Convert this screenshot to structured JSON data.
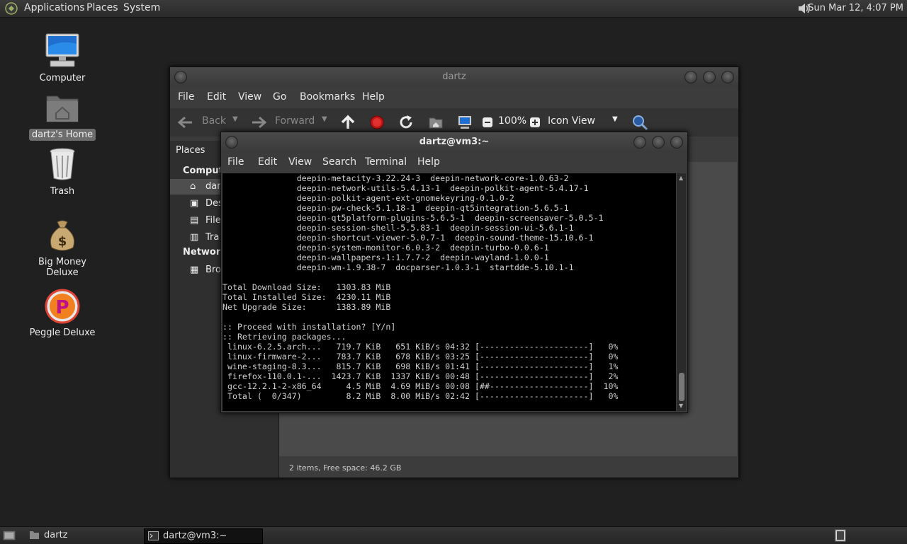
{
  "top_panel": {
    "menus": [
      "Applications",
      "Places",
      "System"
    ],
    "clock": "Sun Mar 12,  4:07 PM"
  },
  "desktop": {
    "icons": [
      {
        "label": "Computer"
      },
      {
        "label": "dartz's Home"
      },
      {
        "label": "Trash"
      },
      {
        "label": "Big Money Deluxe"
      },
      {
        "label": "Peggle Deluxe"
      }
    ]
  },
  "file_manager": {
    "title": "dartz",
    "menu": [
      "File",
      "Edit",
      "View",
      "Go",
      "Bookmarks",
      "Help"
    ],
    "toolbar": {
      "back": "Back",
      "forward": "Forward",
      "zoom": "100%",
      "view_mode": "Icon View"
    },
    "sidebar": {
      "header": "Places",
      "section_computer": "Compute",
      "items": [
        "dar",
        "Des",
        "File",
        "Tra"
      ],
      "section_network": "Network",
      "network_items": [
        "Bro"
      ]
    },
    "status": "2 items, Free space: 46.2 GB"
  },
  "terminal": {
    "title": "dartz@vm3:~",
    "menu": [
      "File",
      "Edit",
      "View",
      "Search",
      "Terminal",
      "Help"
    ],
    "lines": [
      "               deepin-metacity-3.22.24-3  deepin-network-core-1.0.63-2",
      "               deepin-network-utils-5.4.13-1  deepin-polkit-agent-5.4.17-1",
      "               deepin-polkit-agent-ext-gnomekeyring-0.1.0-2",
      "               deepin-pw-check-5.1.18-1  deepin-qt5integration-5.6.5-1",
      "               deepin-qt5platform-plugins-5.6.5-1  deepin-screensaver-5.0.5-1",
      "               deepin-session-shell-5.5.83-1  deepin-session-ui-5.6.1-1",
      "               deepin-shortcut-viewer-5.0.7-1  deepin-sound-theme-15.10.6-1",
      "               deepin-system-monitor-6.0.3-2  deepin-turbo-0.0.6-1",
      "               deepin-wallpapers-1:1.7.7-2  deepin-wayland-1.0.0-1",
      "               deepin-wm-1.9.38-7  docparser-1.0.3-1  startdde-5.10.1-1",
      "",
      "Total Download Size:   1303.83 MiB",
      "Total Installed Size:  4230.11 MiB",
      "Net Upgrade Size:      1383.89 MiB",
      "",
      ":: Proceed with installation? [Y/n]",
      ":: Retrieving packages...",
      " linux-6.2.5.arch...   719.7 KiB   651 KiB/s 04:32 [----------------------]   0%",
      " linux-firmware-2...   783.7 KiB   678 KiB/s 03:25 [----------------------]   0%",
      " wine-staging-8.3...   815.7 KiB   698 KiB/s 01:41 [----------------------]   1%",
      " firefox-110.0.1-...  1423.7 KiB  1337 KiB/s 00:48 [----------------------]   2%",
      " gcc-12.2.1-2-x86_64     4.5 MiB  4.69 MiB/s 00:08 [##--------------------]  10%",
      " Total (  0/347)         8.2 MiB  8.00 MiB/s 02:42 [----------------------]   0%"
    ]
  },
  "taskbar": {
    "tasks": [
      {
        "label": "dartz"
      },
      {
        "label": "dartz@vm3:~"
      }
    ]
  }
}
